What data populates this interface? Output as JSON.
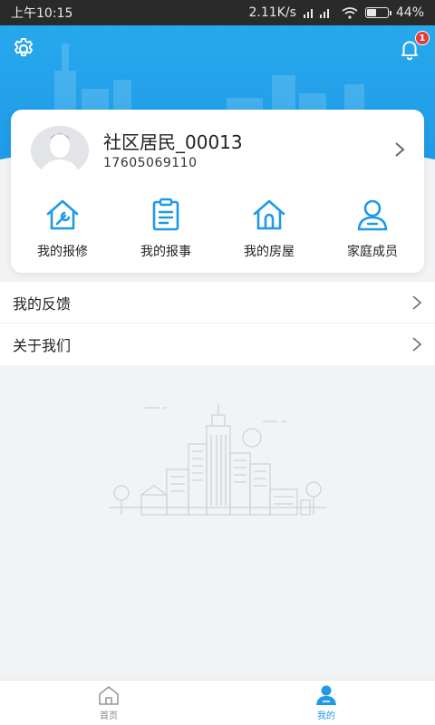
{
  "status_bar": {
    "time": "上午10:15",
    "network_speed": "2.11K/s",
    "battery_percent": "44%",
    "battery_level": 0.44
  },
  "header": {
    "settings_icon": "gear-icon",
    "notification_icon": "bell-icon",
    "notification_badge": "1"
  },
  "profile": {
    "name": "社区居民_00013",
    "phone": "17605069110"
  },
  "quick_actions": [
    {
      "label": "我的报修",
      "icon": "house-wrench-icon"
    },
    {
      "label": "我的报事",
      "icon": "clipboard-icon"
    },
    {
      "label": "我的房屋",
      "icon": "house-icon"
    },
    {
      "label": "家庭成员",
      "icon": "person-icon"
    }
  ],
  "menu": [
    {
      "label": "我的反馈"
    },
    {
      "label": "关于我们"
    }
  ],
  "tab_bar": {
    "tabs": [
      {
        "label": "首页",
        "icon": "home-icon",
        "active": false
      },
      {
        "label": "我的",
        "icon": "user-icon",
        "active": true
      }
    ]
  },
  "colors": {
    "primary": "#1e9ae6",
    "badge": "#e53935"
  }
}
